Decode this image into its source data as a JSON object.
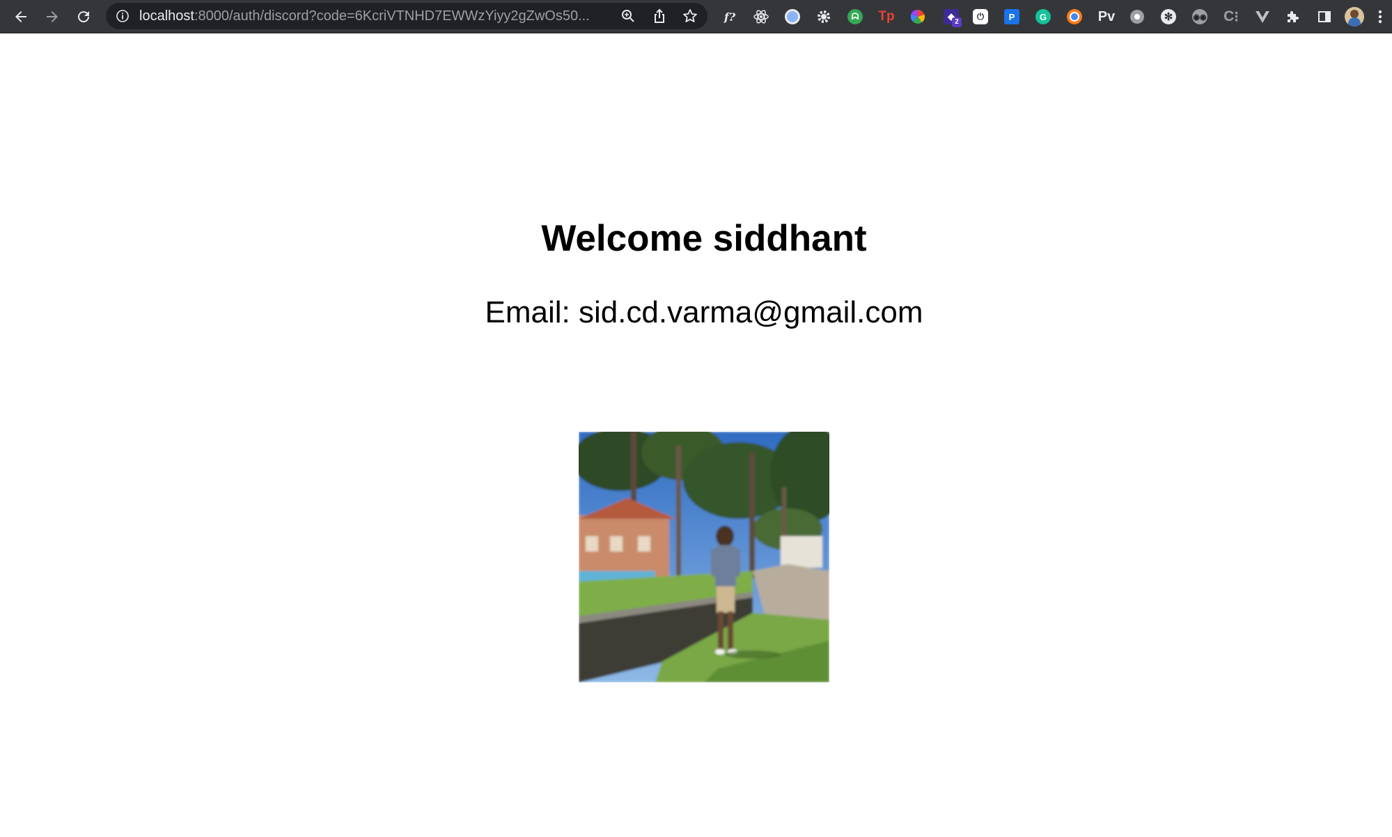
{
  "browser": {
    "url_host": "localhost",
    "url_rest": ":8000/auth/discord?code=6KcriVTNHD7EWWzYiyy2gZwOs50...",
    "extensions": [
      {
        "name": "fx",
        "label": "f?"
      },
      {
        "name": "react",
        "label": ""
      },
      {
        "name": "circle-blue",
        "label": ""
      },
      {
        "name": "gear",
        "label": ""
      },
      {
        "name": "green-octo",
        "label": ""
      },
      {
        "name": "tp",
        "label": "Tp"
      },
      {
        "name": "color-wheel",
        "label": ""
      },
      {
        "name": "purple",
        "label": "2"
      },
      {
        "name": "power",
        "label": ""
      },
      {
        "name": "p-blue",
        "label": "P"
      },
      {
        "name": "grammarly",
        "label": "G"
      },
      {
        "name": "orange-circle",
        "label": ""
      },
      {
        "name": "pv",
        "label": "Pv"
      },
      {
        "name": "grey-circle",
        "label": ""
      },
      {
        "name": "openai",
        "label": ""
      },
      {
        "name": "eyes",
        "label": ""
      },
      {
        "name": "bracket",
        "label": "C"
      },
      {
        "name": "vue",
        "label": ""
      }
    ]
  },
  "page": {
    "welcome": "Welcome siddhant",
    "email": "Email: sid.cd.varma@gmail.com"
  },
  "colors": {
    "toolbar": "#35363a",
    "omnibox": "#202124",
    "text": "#000000"
  }
}
